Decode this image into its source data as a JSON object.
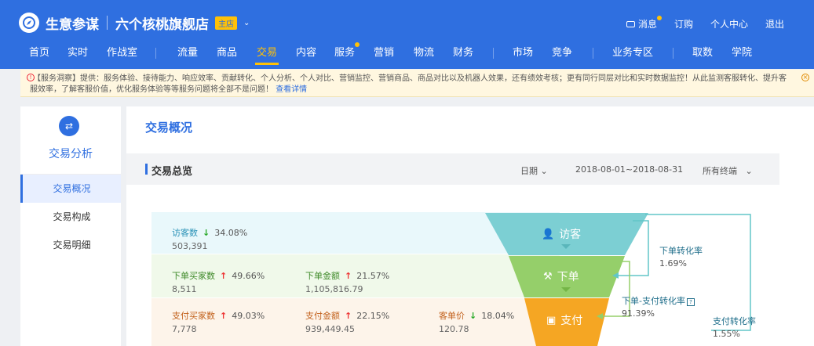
{
  "header": {
    "brand": "生意参谋",
    "shop_name": "六个核桃旗舰店",
    "shop_badge": "主店",
    "links": {
      "message": "消息",
      "subscribe": "订购",
      "personal": "个人中心",
      "logout": "退出"
    }
  },
  "nav": {
    "items": [
      "首页",
      "实时",
      "作战室",
      "流量",
      "商品",
      "交易",
      "内容",
      "服务",
      "营销",
      "物流",
      "财务",
      "市场",
      "竞争",
      "业务专区",
      "取数",
      "学院"
    ],
    "active": "交易"
  },
  "notice": {
    "text": "【服务洞察】提供：服务体验、接待能力、响应效率、贡献转化、个人分析、个人对比、营销监控、营销商品、商品对比以及机器人效果，还有绩效考核；更有同行同层对比和实时数据监控！从此监测客服转化、提升客服效率，了解客服价值，优化服务体验等等服务问题将全部不是问题！",
    "link": "查看详情"
  },
  "sidebar": {
    "title": "交易分析",
    "items": [
      "交易概况",
      "交易构成",
      "交易明细"
    ],
    "active": "交易概况"
  },
  "main": {
    "title": "交易概况",
    "section_title": "交易总览",
    "date_type": "日期",
    "date_range": "2018-08-01~2018-08-31",
    "terminal": "所有终端"
  },
  "metrics": {
    "visitors": {
      "label": "访客数",
      "change": "34.08%",
      "direction": "down",
      "value": "503,391"
    },
    "order_buyers": {
      "label": "下单买家数",
      "change": "49.66%",
      "direction": "up",
      "value": "8,511"
    },
    "order_amount": {
      "label": "下单金额",
      "change": "21.57%",
      "direction": "up",
      "value": "1,105,816.79"
    },
    "pay_buyers": {
      "label": "支付买家数",
      "change": "49.03%",
      "direction": "up",
      "value": "7,778"
    },
    "pay_amount": {
      "label": "支付金额",
      "change": "22.15%",
      "direction": "up",
      "value": "939,449.45"
    },
    "avg_price": {
      "label": "客单价",
      "change": "18.04%",
      "direction": "down",
      "value": "120.78"
    }
  },
  "funnel": {
    "stages": [
      "访客",
      "下单",
      "支付"
    ],
    "colors": {
      "visit": "#7ccfd3",
      "order": "#95cf6a",
      "pay": "#f5a623"
    },
    "conversions": {
      "order": {
        "label": "下单转化率",
        "value": "1.69%"
      },
      "order_to_pay": {
        "label": "下单-支付转化率",
        "value": "91.39%"
      },
      "pay": {
        "label": "支付转化率",
        "value": "1.55%"
      }
    }
  }
}
